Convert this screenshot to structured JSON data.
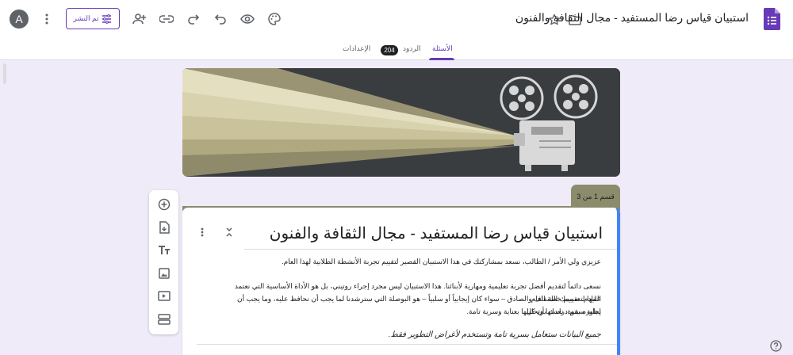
{
  "header": {
    "avatar_letter": "A",
    "publish_label": "تم النشر",
    "form_title": "استبيان قياس رضا المستفيد - مجال الثقافة والفنون",
    "icons": [
      "more-vert-icon",
      "add-collaborator-icon",
      "link-icon",
      "redo-icon",
      "undo-icon",
      "preview-eye-icon",
      "palette-icon",
      "star-icon",
      "folder-icon",
      "forms-logo-icon"
    ]
  },
  "tabs": {
    "questions": "الأسئلة",
    "responses": "الردود",
    "responses_count": "204",
    "settings": "الإعدادات"
  },
  "section": {
    "label": "قسم 1 من 3"
  },
  "card": {
    "title": "استبيان قياس رضا المستفيد - مجال الثقافة والفنون",
    "greeting": "عزيزي ولي الأمر / الطالب، نسعد بمشاركتك في هذا الاستبيان القصير لتقييم تجربة الأنشطة الطلابية لهذا العام.",
    "paragraph_line1": "نسعى دائماً لتقديم أفضل تجربة تعليمية ومهارية لأبنائنا. هذا الاستبيان ليس مجرد إجراء روتيني، بل هو الأداة الأساسية التي نعتمد عليها لتصميم خطة العام",
    "paragraph_line2": "القادم. تقييمك الشفاف والصادق – سواء كان إيجابياً أو سلبياً – هو البوصلة التي سترشدنا لما يجب أن نحافظ عليه، وما يجب أن نطوره بقوة. نعدك بأن كل",
    "paragraph_line3": "إجابة سيتم دراستها وتحليلها بعناية وسرية تامة.",
    "note": "جميع البيانات ستعامل بسرية تامة وتستخدم لأغراض التطوير فقط."
  },
  "toolbar": {
    "items": [
      "add-question-icon",
      "import-questions-icon",
      "add-title-icon",
      "add-image-icon",
      "add-video-icon",
      "add-section-icon"
    ]
  },
  "colors": {
    "accent": "#673ab7",
    "background": "#f0ebf8",
    "section": "#8a8c6c",
    "focus": "#4285f4"
  }
}
